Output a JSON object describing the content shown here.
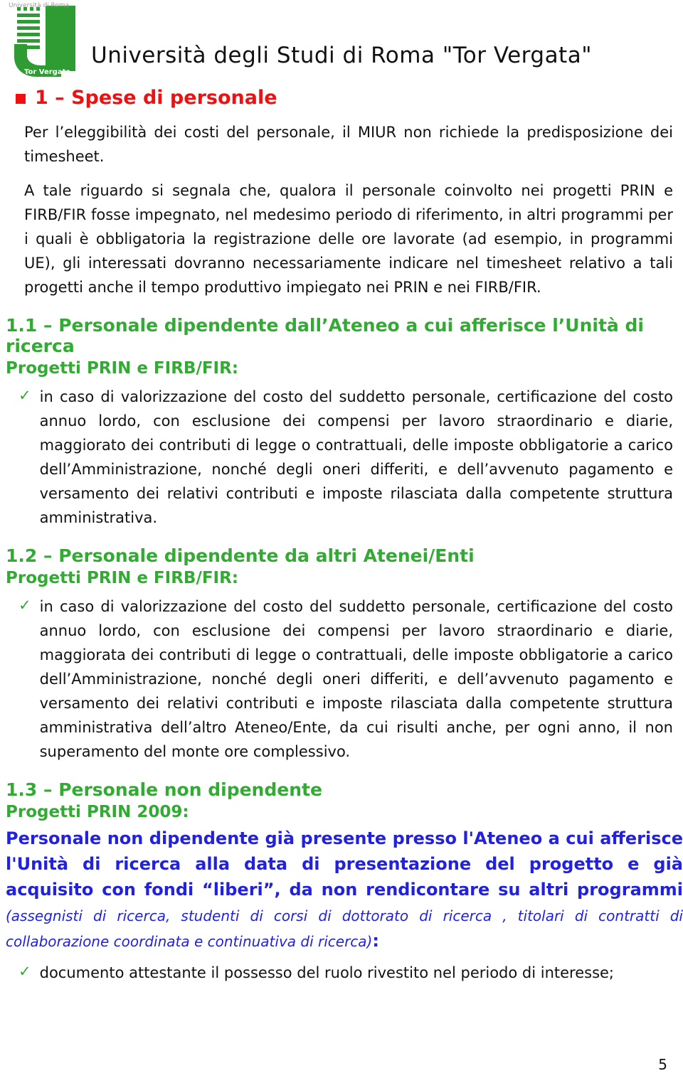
{
  "logo": {
    "top_text": "Università di Roma",
    "bottom_text": "Tor Vergata",
    "color": "#2e9b33",
    "top_text_color": "#9a9a9a"
  },
  "header": {
    "title": "Università degli Studi di Roma \"Tor Vergata\""
  },
  "section1": {
    "heading": "1 – Spese di personale",
    "heading_color": "#ee1111",
    "para1": "Per l’eleggibilità dei costi del personale, il MIUR non richiede la predisposizione dei timesheet.",
    "para2": "A tale riguardo si segnala che, qualora il personale coinvolto nei progetti PRIN e FIRB/FIR fosse impegnato, nel medesimo periodo di riferimento, in altri programmi per i quali è obbligatoria la registrazione delle ore lavorate (ad esempio, in programmi UE), gli interessati dovranno necessariamente indicare nel timesheet relativo a tali progetti anche il tempo produttivo impiegato nei PRIN e nei FIRB/FIR."
  },
  "section1_1": {
    "heading": "1.1 – Personale dipendente dall’Ateneo a cui afferisce l’Unità di ricerca",
    "subhead": "Progetti PRIN e FIRB/FIR:",
    "heading_color": "#33aa33",
    "check_glyph": "✓",
    "items": [
      "in caso di valorizzazione del costo del suddetto personale, certificazione del costo annuo lordo, con esclusione dei compensi per lavoro straordinario e diarie, maggiorato dei contributi di legge o contrattuali, delle imposte obbligatorie a carico dell’Amministrazione, nonché degli oneri differiti, e dell’avvenuto pagamento e versamento dei relativi contributi e imposte rilasciata dalla competente struttura amministrativa."
    ]
  },
  "section1_2": {
    "heading": "1.2 – Personale dipendente da altri Atenei/Enti",
    "subhead": "Progetti PRIN e FIRB/FIR:",
    "heading_color": "#33aa33",
    "check_glyph": "✓",
    "items": [
      "in caso di valorizzazione del costo del suddetto personale, certificazione del costo annuo lordo, con esclusione dei compensi per lavoro straordinario e diarie, maggiorata dei contributi di legge o contrattuali, delle imposte obbligatorie a carico dell’Amministrazione, nonché degli oneri differiti, e dell’avvenuto pagamento e versamento dei relativi contributi e imposte rilasciata dalla competente struttura amministrativa dell’altro Ateneo/Ente, da cui risulti anche, per ogni anno, il non superamento del monte ore complessivo."
    ]
  },
  "section1_3": {
    "heading": "1.3 – Personale non dipendente",
    "subhead": "Progetti PRIN 2009:",
    "heading_color": "#33aa33",
    "blue_color": "#2222dd",
    "blue_bold_1": "Personale non dipendente già presente presso l'Ateneo a cui afferisce l'Unità di ricerca alla data di presentazione del progetto e già acquisito con fondi “liberi”, da non rendicontare su altri programmi",
    "blue_italic": "(assegnisti di ricerca, studenti di corsi di dottorato di ricerca , titolari di contratti di collaborazione coordinata e continuativa di ricerca)",
    "blue_colon": ":",
    "check_glyph": "✓",
    "items": [
      "documento attestante il possesso del ruolo rivestito nel periodo di interesse;"
    ]
  },
  "footer": {
    "page_number": "5"
  }
}
